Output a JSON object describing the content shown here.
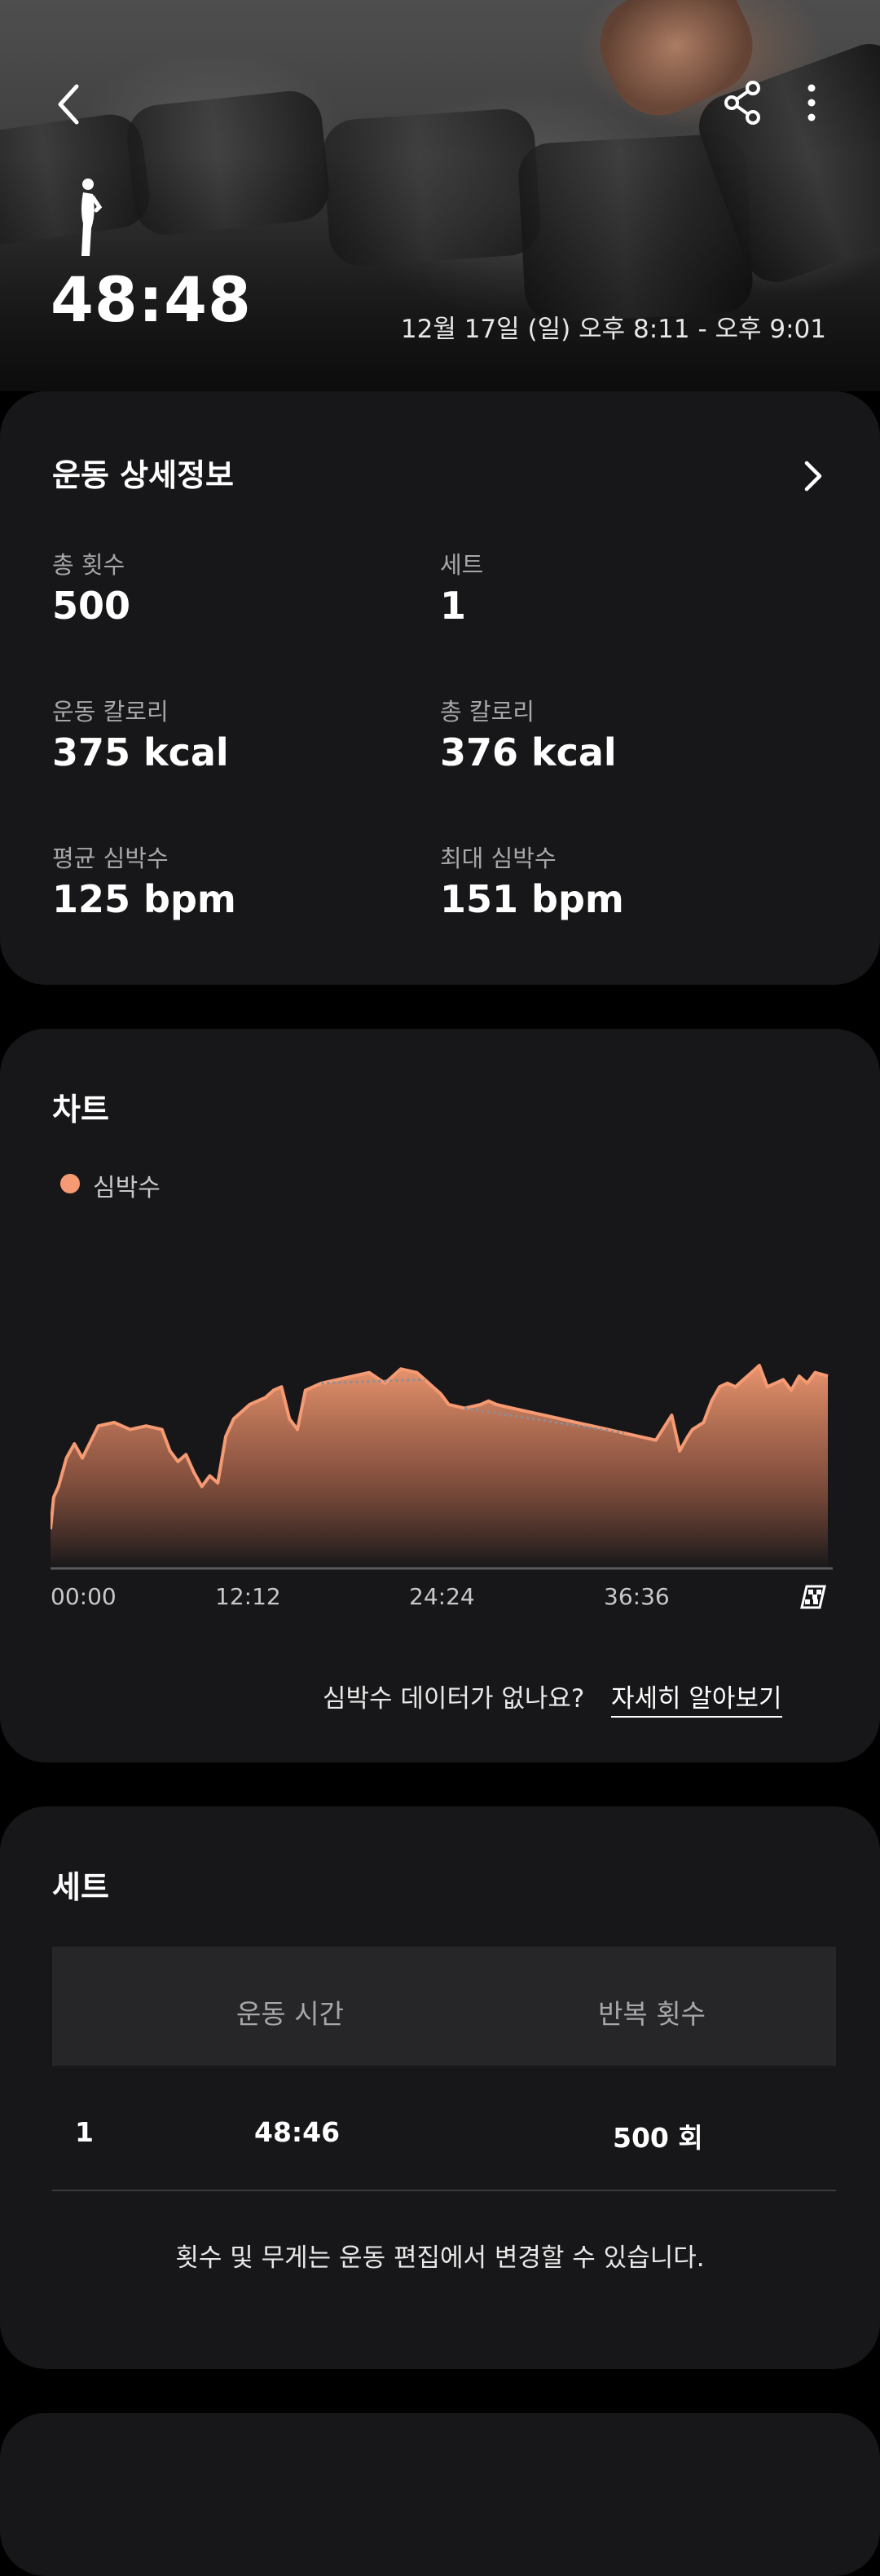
{
  "header": {
    "duration": "48:48",
    "date_range": "12월 17일 (일) 오후 8:11 - 오후 9:01",
    "back_icon": "chevron-left-icon",
    "share_icon": "share-icon",
    "more_icon": "more-vertical-icon",
    "workout_icon": "dumbbell-curl-icon"
  },
  "details": {
    "title": "운동 상세정보",
    "stats": [
      {
        "label": "총 횟수",
        "value": "500"
      },
      {
        "label": "세트",
        "value": "1"
      },
      {
        "label": "운동 칼로리",
        "value": "375 kcal"
      },
      {
        "label": "총 칼로리",
        "value": "376 kcal"
      },
      {
        "label": "평균 심박수",
        "value": "125 bpm"
      },
      {
        "label": "최대 심박수",
        "value": "151 bpm"
      }
    ]
  },
  "chart": {
    "title": "차트",
    "legend": "심박수",
    "no_data_text": "심박수 데이터가 없나요?",
    "learn_more": "자세히 알아보기"
  },
  "chart_data": {
    "type": "area",
    "series": [
      {
        "name": "심박수",
        "color": "#f59a73"
      }
    ],
    "x_ticks": [
      "00:00",
      "12:12",
      "24:24",
      "36:36"
    ],
    "x": [
      0,
      0.2,
      0.5,
      1,
      1.5,
      2,
      3,
      4,
      5,
      6,
      7,
      7.5,
      8,
      8.5,
      9,
      9.5,
      10,
      10.5,
      11,
      11.5,
      12.5,
      13,
      13.5,
      14,
      14.5,
      15,
      15.5,
      16,
      17,
      18,
      19,
      20,
      21,
      22,
      23,
      23.5,
      24,
      24.5,
      25,
      26,
      27,
      27.5,
      28,
      29,
      30,
      31,
      32,
      33,
      34,
      35,
      36,
      37,
      38,
      39,
      39.5,
      40,
      40.3,
      41,
      41.5,
      42,
      42.5,
      43,
      43.5,
      44,
      44.5,
      45,
      46,
      46.5,
      47,
      47.5,
      48,
      48.8
    ],
    "y": [
      106,
      115,
      118,
      126,
      130,
      126,
      135,
      136,
      134,
      135,
      134,
      128,
      125,
      127,
      122,
      118,
      121,
      119,
      132,
      137,
      141,
      142,
      143,
      145,
      146,
      137,
      134,
      145,
      147,
      148,
      149,
      150,
      147,
      151,
      150,
      148,
      146,
      144,
      141,
      140,
      141,
      142,
      141,
      140,
      139,
      138,
      137,
      136,
      135,
      134,
      133,
      132,
      131,
      138,
      128,
      132,
      134,
      136,
      142,
      146,
      147,
      146,
      148,
      150,
      152,
      146,
      148,
      145,
      149,
      147,
      150,
      149
    ],
    "gaps": [
      [
        17,
        23.5
      ],
      [
        26,
        35.5
      ]
    ],
    "ylim": [
      95,
      160
    ],
    "end_marker_icon": "finish-flag-icon"
  },
  "sets": {
    "title": "세트",
    "columns": [
      "운동 시간",
      "반복 횟수"
    ],
    "rows": [
      {
        "set": "1",
        "time": "48:46",
        "reps": "500 회"
      }
    ],
    "note": "횟수 및 무게는 운동 편집에서 변경할 수 있습니다."
  }
}
